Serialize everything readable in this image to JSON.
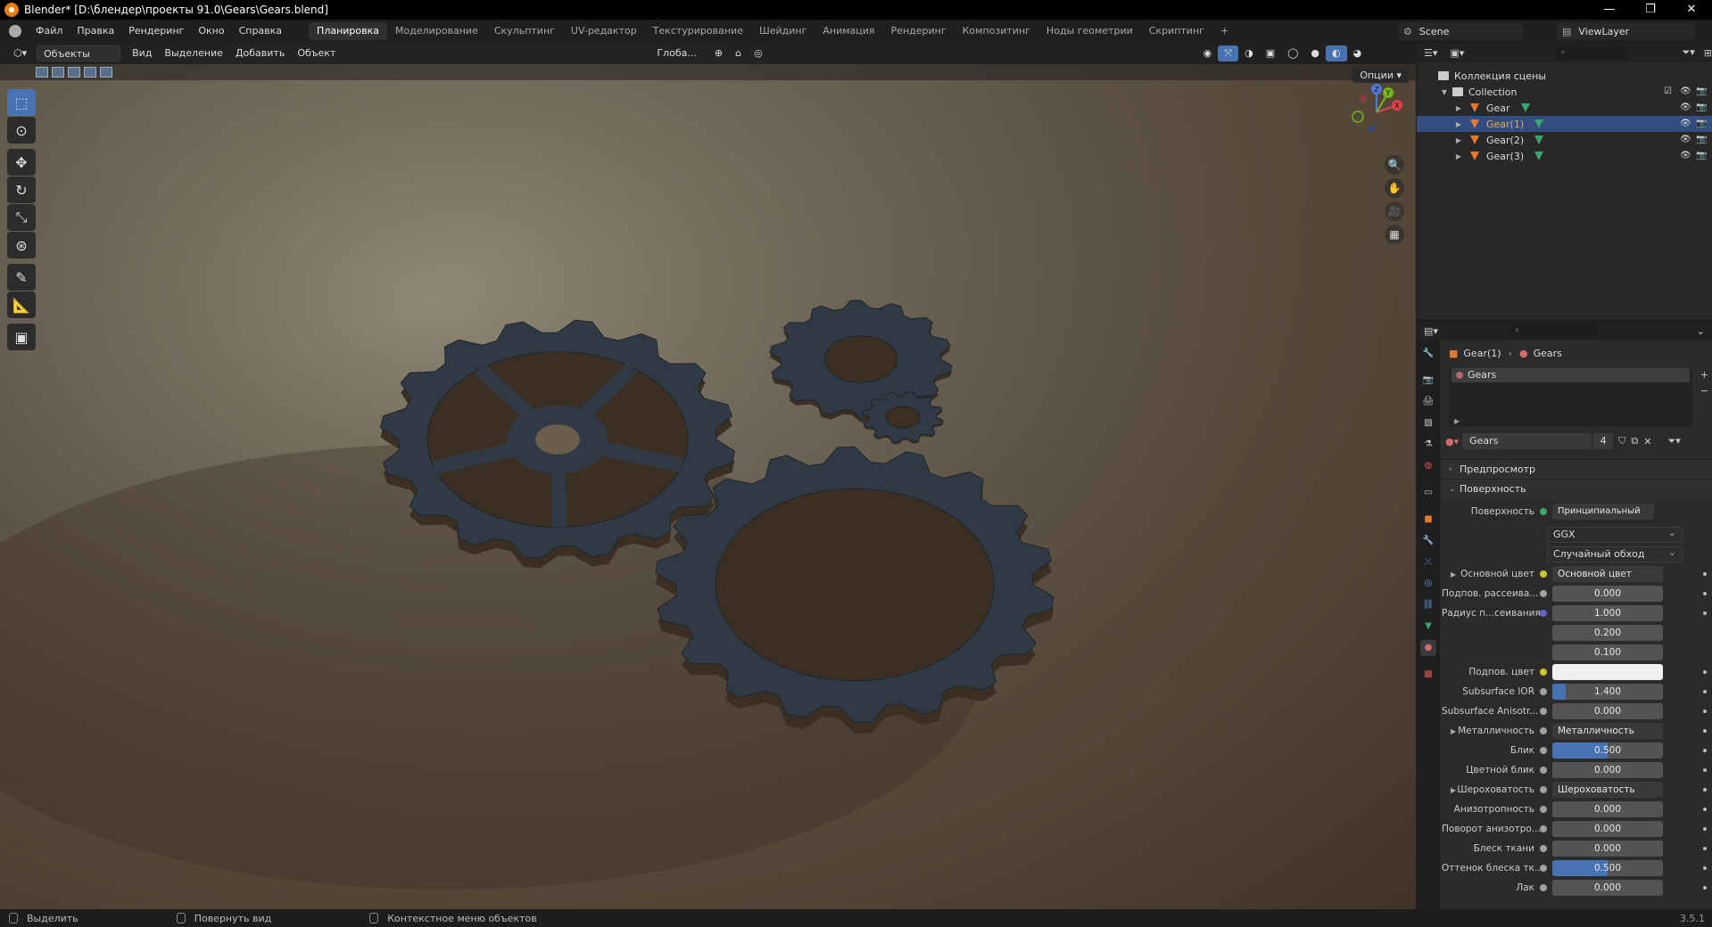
{
  "window": {
    "title": "Blender* [D:\\блендер\\проекты 91.0\\Gears\\Gears.blend]",
    "minimize": "—",
    "restore": "❐",
    "close": "✕"
  },
  "menu": [
    "Файл",
    "Правка",
    "Рендеринг",
    "Окно",
    "Справка"
  ],
  "workspaces": [
    "Планировка",
    "Моделирование",
    "Скульптинг",
    "UV-редактор",
    "Текстурирование",
    "Шейдинг",
    "Анимация",
    "Рендеринг",
    "Композитинг",
    "Ноды геометрии",
    "Скриптинг"
  ],
  "workspace_add": "+",
  "scene": {
    "name": "Scene",
    "view_layer": "ViewLayer"
  },
  "viewport": {
    "mode": "Объекты",
    "menus": [
      "Вид",
      "Выделение",
      "Добавить",
      "Объект"
    ],
    "transform_orientation": "Глоба...",
    "options": "Опции",
    "gizmo": {
      "x": "X",
      "y": "Y",
      "z": "Z"
    }
  },
  "tools": [
    "select-box",
    "cursor",
    "move",
    "rotate",
    "scale",
    "transform",
    "annotate",
    "measure",
    "add-cube"
  ],
  "outliner": {
    "root": "Коллекция сцены",
    "collection": "Collection",
    "objects": [
      {
        "name": "Gear",
        "selected": false
      },
      {
        "name": "Gear(1)",
        "selected": true
      },
      {
        "name": "Gear(2)",
        "selected": false
      },
      {
        "name": "Gear(3)",
        "selected": false
      }
    ]
  },
  "properties": {
    "breadcrumb": {
      "object": "Gear(1)",
      "material": "Gears"
    },
    "slot": "Gears",
    "material": {
      "name": "Gears",
      "users": "4"
    },
    "sections": {
      "preview": "Предпросмотр",
      "surface": "Поверхность"
    },
    "surface_label": "Поверхность",
    "surface_value": "Принципиальный BSDF",
    "distribution": "GGX",
    "subsurface_method": "Случайный обход",
    "rows": [
      {
        "label": "Основной цвет",
        "value": "Основной цвет",
        "type": "link",
        "sock": "#c7c729",
        "exp": true
      },
      {
        "label": "Подпов. рассеива...",
        "value": "0.000",
        "type": "num",
        "sock": "#a1a1a1",
        "fill": 0
      },
      {
        "label": "Радиус п...сеивания",
        "value": "1.000",
        "type": "num",
        "sock": "#6363c7",
        "fill": 0
      },
      {
        "label": "",
        "value": "0.200",
        "type": "num",
        "sock": "",
        "fill": 0
      },
      {
        "label": "",
        "value": "0.100",
        "type": "num",
        "sock": "",
        "fill": 0
      },
      {
        "label": "Подпов. цвет",
        "value": "",
        "type": "color",
        "sock": "#c7c729"
      },
      {
        "label": "Subsurface IOR",
        "value": "1.400",
        "type": "num",
        "sock": "#a1a1a1",
        "fill": 0.12
      },
      {
        "label": "Subsurface Anisotr...",
        "value": "0.000",
        "type": "num",
        "sock": "#a1a1a1",
        "fill": 0
      },
      {
        "label": "Металличность",
        "value": "Металличность",
        "type": "link",
        "sock": "#a1a1a1",
        "exp": true
      },
      {
        "label": "Блик",
        "value": "0.500",
        "type": "num",
        "sock": "#a1a1a1",
        "fill": 0.5
      },
      {
        "label": "Цветной блик",
        "value": "0.000",
        "type": "num",
        "sock": "#a1a1a1",
        "fill": 0
      },
      {
        "label": "Шероховатость",
        "value": "Шероховатость",
        "type": "link",
        "sock": "#a1a1a1",
        "exp": true
      },
      {
        "label": "Анизотропность",
        "value": "0.000",
        "type": "num",
        "sock": "#a1a1a1",
        "fill": 0
      },
      {
        "label": "Поворот анизотро...",
        "value": "0.000",
        "type": "num",
        "sock": "#a1a1a1",
        "fill": 0
      },
      {
        "label": "Блеск ткани",
        "value": "0.000",
        "type": "num",
        "sock": "#a1a1a1",
        "fill": 0
      },
      {
        "label": "Оттенок блеска тк...",
        "value": "0.500",
        "type": "num",
        "sock": "#a1a1a1",
        "fill": 0.5
      },
      {
        "label": "Лак",
        "value": "0.000",
        "type": "num",
        "sock": "#a1a1a1",
        "fill": 0
      }
    ]
  },
  "status": {
    "select": "Выделить",
    "rotate": "Повернуть вид",
    "context": "Контекстное меню объектов",
    "version": "3.5.1"
  }
}
